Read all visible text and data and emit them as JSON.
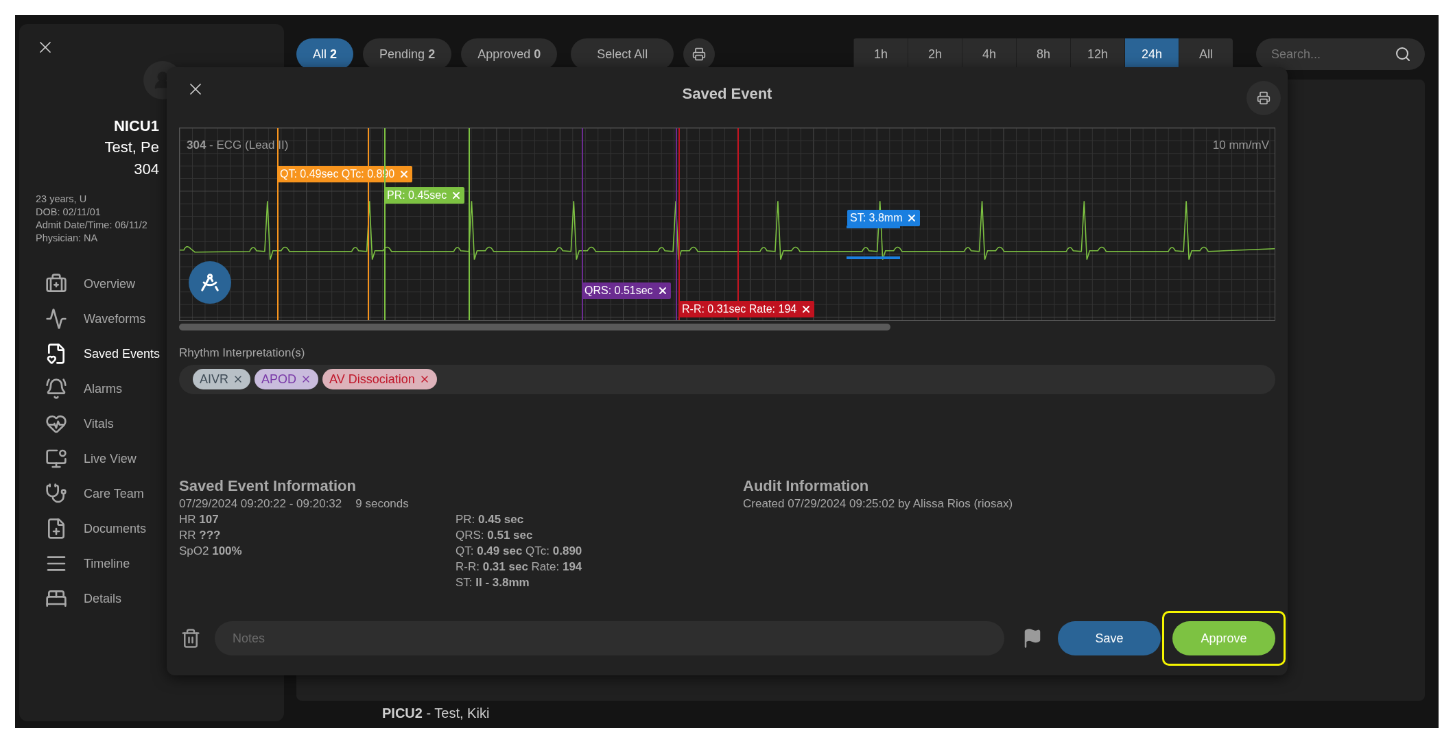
{
  "sidebar": {
    "patient": {
      "unit": "NICU1",
      "name": "Test, Pe",
      "room": "304",
      "details": [
        "23 years, U",
        "DOB: 02/11/01",
        "Admit Date/Time: 06/11/2",
        "Physician: NA"
      ]
    },
    "items": [
      {
        "label": "Overview",
        "selected": false
      },
      {
        "label": "Waveforms",
        "selected": false
      },
      {
        "label": "Saved Events",
        "selected": true
      },
      {
        "label": "Alarms",
        "selected": false
      },
      {
        "label": "Vitals",
        "selected": false
      },
      {
        "label": "Live View",
        "selected": false
      },
      {
        "label": "Care Team",
        "selected": false
      },
      {
        "label": "Documents",
        "selected": false
      },
      {
        "label": "Timeline",
        "selected": false
      },
      {
        "label": "Details",
        "selected": false
      }
    ]
  },
  "filters": [
    {
      "label": "All",
      "count": "2",
      "selected": true
    },
    {
      "label": "Pending",
      "count": "2",
      "selected": false
    },
    {
      "label": "Approved",
      "count": "0",
      "selected": false
    }
  ],
  "select_all": "Select All",
  "ranges": [
    {
      "label": "1h",
      "selected": false
    },
    {
      "label": "2h",
      "selected": false
    },
    {
      "label": "4h",
      "selected": false
    },
    {
      "label": "8h",
      "selected": false
    },
    {
      "label": "12h",
      "selected": false
    },
    {
      "label": "24h",
      "selected": true
    },
    {
      "label": "All",
      "selected": false
    }
  ],
  "search": {
    "placeholder": "Search..."
  },
  "list_peek": "**PICU2** - Test, Kiki",
  "modal": {
    "title": "Saved Event",
    "strip": {
      "caption": "**304** - ECG (Lead II)",
      "scale": "10 mm/mV",
      "markers": [
        {
          "label": "QT: 0.49sec QTc: 0.890",
          "color": "#f7941d",
          "kind": "interval"
        },
        {
          "label": "PR: 0.45sec",
          "color": "#7dc242",
          "kind": "interval"
        },
        {
          "label": "ST: 3.8mm",
          "color": "#1a7fe0",
          "kind": "st"
        },
        {
          "label": "QRS: 0.51sec",
          "color": "#6b2c91",
          "kind": "interval"
        },
        {
          "label": "R-R: 0.31sec Rate: 194",
          "color": "#c1121f",
          "kind": "interval"
        }
      ]
    },
    "rhythm_label": "Rhythm Interpretation(s)",
    "rhythms": [
      {
        "label": "AIVR",
        "color": "#3d4a55"
      },
      {
        "label": "APOD",
        "color": "#7a3aa8"
      },
      {
        "label": "AV Dissociation",
        "color": "#c0172a"
      }
    ],
    "info": {
      "title": "Saved Event Information",
      "range": "07/29/2024 09:20:22 - 09:20:32",
      "duration": "9 seconds",
      "vitals": [
        "HR **107**",
        "RR **???**",
        "SpO2 **100%**"
      ],
      "measurements": [
        "PR: **0.45 sec**",
        "QRS: **0.51 sec**",
        "QT: **0.49 sec** QTc: **0.890**",
        "R-R: **0.31 sec** Rate: **194**",
        "ST: **II - 3.8mm**"
      ]
    },
    "audit": {
      "title": "Audit Information",
      "text": "Created 07/29/2024 09:25:02 by Alissa Rios (riosax)"
    },
    "notes": {
      "placeholder": "Notes"
    },
    "buttons": [
      {
        "label": "Save",
        "kind": "save",
        "highlighted": false
      },
      {
        "label": "Approve",
        "kind": "approve",
        "highlighted": true
      }
    ]
  }
}
